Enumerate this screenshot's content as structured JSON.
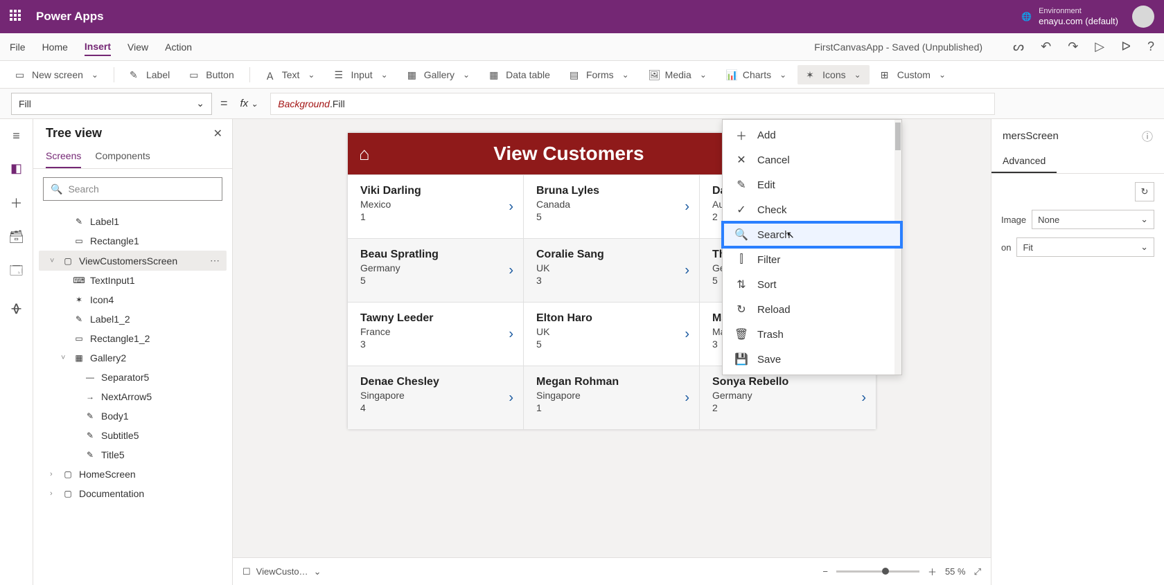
{
  "topbar": {
    "app_title": "Power Apps",
    "env_label": "Environment",
    "env_name": "enayu.com (default)"
  },
  "menubar": {
    "items": [
      "File",
      "Home",
      "Insert",
      "View",
      "Action"
    ],
    "active_index": 2,
    "status": "FirstCanvasApp - Saved (Unpublished)"
  },
  "toolbar": {
    "new_screen": "New screen",
    "label": "Label",
    "button": "Button",
    "text": "Text",
    "input": "Input",
    "gallery": "Gallery",
    "data_table": "Data table",
    "forms": "Forms",
    "media": "Media",
    "charts": "Charts",
    "icons": "Icons",
    "custom": "Custom"
  },
  "formula": {
    "property": "Fill",
    "fx": "fx",
    "expr_obj": "Background",
    "expr_prop": ".Fill"
  },
  "tree": {
    "title": "Tree view",
    "tabs": [
      "Screens",
      "Components"
    ],
    "active_tab": 0,
    "search_placeholder": "Search",
    "nodes": [
      {
        "indent": 2,
        "icon": "label",
        "label": "Label1"
      },
      {
        "indent": 2,
        "icon": "rect",
        "label": "Rectangle1"
      },
      {
        "indent": 1,
        "icon": "screen",
        "label": "ViewCustomersScreen",
        "selected": true,
        "expanded": true,
        "ellipsis": true
      },
      {
        "indent": 2,
        "icon": "textinput",
        "label": "TextInput1"
      },
      {
        "indent": 2,
        "icon": "icon",
        "label": "Icon4"
      },
      {
        "indent": 2,
        "icon": "label",
        "label": "Label1_2"
      },
      {
        "indent": 2,
        "icon": "rect",
        "label": "Rectangle1_2"
      },
      {
        "indent": 2,
        "icon": "gallery",
        "label": "Gallery2",
        "expanded": true
      },
      {
        "indent": 3,
        "icon": "sep",
        "label": "Separator5"
      },
      {
        "indent": 3,
        "icon": "arrow",
        "label": "NextArrow5"
      },
      {
        "indent": 3,
        "icon": "label",
        "label": "Body1"
      },
      {
        "indent": 3,
        "icon": "label",
        "label": "Subtitle5"
      },
      {
        "indent": 3,
        "icon": "label",
        "label": "Title5"
      },
      {
        "indent": 1,
        "icon": "screen",
        "label": "HomeScreen",
        "collapsed": true
      },
      {
        "indent": 1,
        "icon": "screen",
        "label": "Documentation",
        "collapsed": true
      }
    ]
  },
  "canvas": {
    "header_title": "View Customers",
    "customers": [
      {
        "name": "Viki Darling",
        "country": "Mexico",
        "num": "1"
      },
      {
        "name": "Bruna Lyles",
        "country": "Canada",
        "num": "5"
      },
      {
        "name": "Daine Zamora",
        "country": "Australia",
        "num": "2"
      },
      {
        "name": "Beau Spratling",
        "country": "Germany",
        "num": "5"
      },
      {
        "name": "Coralie Sang",
        "country": "UK",
        "num": "3"
      },
      {
        "name": "Thresa Milstead",
        "country": "Germany",
        "num": "5"
      },
      {
        "name": "Tawny Leeder",
        "country": "France",
        "num": "3"
      },
      {
        "name": "Elton Haro",
        "country": "UK",
        "num": "5"
      },
      {
        "name": "Madaline Neblett",
        "country": "Malayasia",
        "num": "3"
      },
      {
        "name": "Denae Chesley",
        "country": "Singapore",
        "num": "4"
      },
      {
        "name": "Megan Rohman",
        "country": "Singapore",
        "num": "1"
      },
      {
        "name": "Sonya Rebello",
        "country": "Germany",
        "num": "2"
      }
    ],
    "footer_crumb": "ViewCusto…",
    "zoom": "55 %"
  },
  "dropdown": {
    "items": [
      {
        "icon": "＋",
        "label": "Add"
      },
      {
        "icon": "✕",
        "label": "Cancel"
      },
      {
        "icon": "✎",
        "label": "Edit"
      },
      {
        "icon": "✓",
        "label": "Check"
      },
      {
        "icon": "🔍",
        "label": "Search",
        "highlight": true
      },
      {
        "icon": "⫿",
        "label": "Filter"
      },
      {
        "icon": "⇅",
        "label": "Sort"
      },
      {
        "icon": "↻",
        "label": "Reload"
      },
      {
        "icon": "🗑",
        "label": "Trash"
      },
      {
        "icon": "💾",
        "label": "Save"
      }
    ]
  },
  "right_pane": {
    "title_suffix": "mersScreen",
    "tab_advanced": "Advanced",
    "row_image_label": "Image",
    "row_image_value": "None",
    "row_pos_label": "on",
    "row_pos_value": "Fit"
  }
}
